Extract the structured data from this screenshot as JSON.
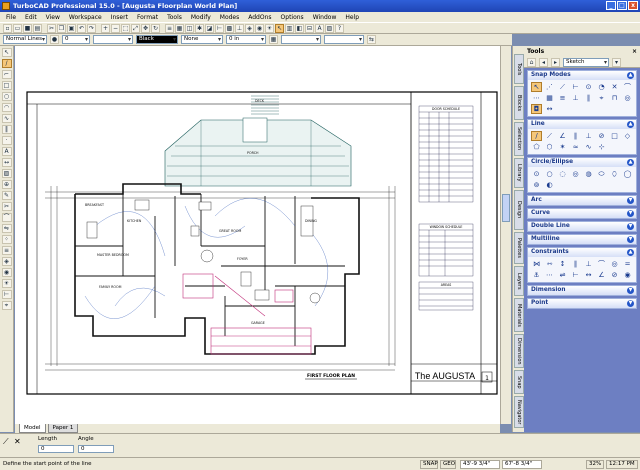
{
  "window": {
    "title": "TurboCAD Professional 15.0 - [Augusta Floorplan World Plan]",
    "controls": [
      "_",
      "□",
      "x"
    ]
  },
  "menu": [
    "File",
    "Edit",
    "View",
    "Workspace",
    "Insert",
    "Format",
    "Tools",
    "Modify",
    "Modes",
    "AddOns",
    "Options",
    "Window",
    "Help"
  ],
  "property_bar": {
    "layer": "Normal Lines",
    "pen_width": "0",
    "color": "Black",
    "line_style": "None",
    "width": "0 in"
  },
  "drawing": {
    "title": "FIRST FLOOR PLAN",
    "sheet_title": "The AUGUSTA",
    "sheet_number": "1",
    "rooms": [
      "BREAKFAST",
      "KITCHEN",
      "FAMILY ROOM",
      "GREAT ROOM",
      "DINING",
      "FOYER",
      "GARAGE",
      "MASTER BEDROOM",
      "PORCH",
      "DECK"
    ],
    "schedules": [
      "DOOR SCHEDULE",
      "WINDOW SCHEDULE",
      "AREAS"
    ]
  },
  "tabs": {
    "model": "Model",
    "paper": "Paper 1"
  },
  "inspector": {
    "length_label": "Length",
    "angle_label": "Angle",
    "length_value": "0",
    "angle_value": "0"
  },
  "status": {
    "message": "Define the start point of the line",
    "snap": "SNAP",
    "geo": "GEO",
    "x": "43'-9 3/4\"",
    "y": "67'-8 3/4\"",
    "zoom": "32%",
    "time": "12:17 PM"
  },
  "tools_panel": {
    "title": "Tools",
    "mode_combo": "Sketch",
    "sections": [
      {
        "name": "Snap Modes",
        "expanded": true
      },
      {
        "name": "Line",
        "expanded": true
      },
      {
        "name": "Circle/Ellipse",
        "expanded": true
      },
      {
        "name": "Arc",
        "expanded": false
      },
      {
        "name": "Curve",
        "expanded": false
      },
      {
        "name": "Double Line",
        "expanded": false
      },
      {
        "name": "Multiline",
        "expanded": false
      },
      {
        "name": "Constraints",
        "expanded": true
      },
      {
        "name": "Dimension",
        "expanded": false
      },
      {
        "name": "Point",
        "expanded": false
      }
    ]
  },
  "side_tabs": [
    "Tools",
    "Blocks",
    "Selection",
    "Library",
    "Design Director",
    "Palettes",
    "Layers",
    "Materials",
    "Dimension",
    "Snap",
    "Navigator"
  ],
  "colors": {
    "title": "#2456c8",
    "panel": "#6d7fc2",
    "accent": "#f5c77a",
    "wall": "#111111",
    "roof": "#1a5c5a",
    "magenta": "#c0307a"
  }
}
